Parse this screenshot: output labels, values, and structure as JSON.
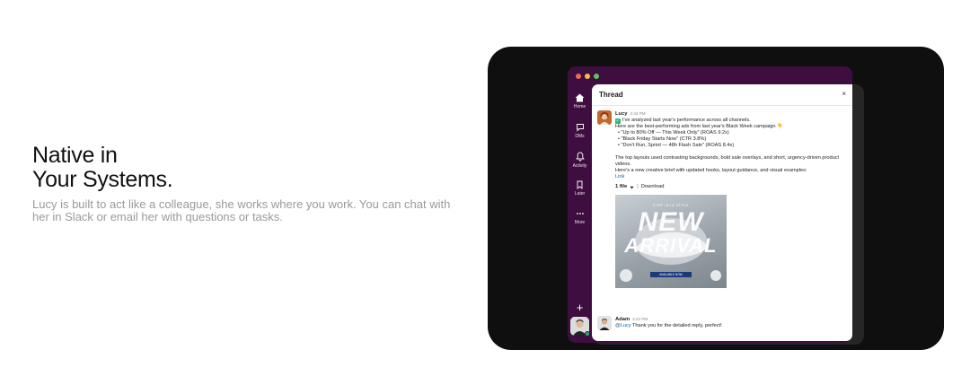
{
  "hero": {
    "title_line1": "Native in",
    "title_line2": "Your Systems.",
    "description": "Lucy is built to act like a colleague, she works where you work. You can chat with her in Slack or email her with questions or tasks."
  },
  "window": {
    "sidebar": [
      {
        "label": "Home",
        "icon": "home-icon"
      },
      {
        "label": "DMs",
        "icon": "chat-bubble-icon"
      },
      {
        "label": "Activity",
        "icon": "bell-icon"
      },
      {
        "label": "Later",
        "icon": "bookmark-icon"
      },
      {
        "label": "More",
        "icon": "more-dots-icon"
      }
    ],
    "add_glyph": "+"
  },
  "thread": {
    "title": "Thread",
    "close_glyph": "×",
    "messages": [
      {
        "author": "Lucy",
        "time": "2:43 PM",
        "line1": "I've analyzed last year's performance across all channels.",
        "line2": "Here are the best-performing ads from last year's Black Week campaign 👇",
        "bullets": [
          "\"Up to 80% Off — This Week Only\" (ROAS 9.2x)",
          "\"Black Friday Starts Now\" (CTR 3.8%)",
          "\"Don't Run, Sprint — 48h Flash Sale\" (ROAS 8.4x)"
        ],
        "para1": "The top layouts used contrasting backgrounds, bold sale overlays, and short, urgency-driven product videos.",
        "para2": "Here's a new creative brief with updated hooks, layout guidance, and visual examples:",
        "link": "Link",
        "file_count": "1 file",
        "download": "Download",
        "attachment": {
          "top_text": "STEP INTO STYLE",
          "headline1": "NEW",
          "headline2": "ARRIVAL",
          "button": "AVAILABLE NOW"
        }
      },
      {
        "author": "Adam",
        "time": "2:44 PM",
        "mention": "@Lucy",
        "text": "Thank you for the detailed reply, perfect!"
      }
    ]
  },
  "colors": {
    "sidebar": "#3f0e40",
    "stage": "#0f0f0f",
    "link": "#1264a3",
    "status_online": "#2bac76"
  }
}
